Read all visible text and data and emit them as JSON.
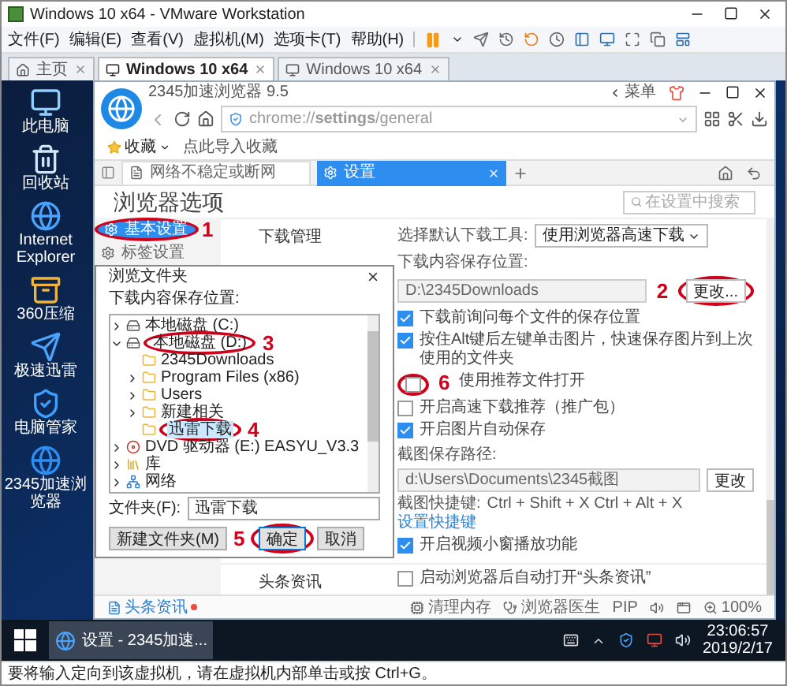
{
  "window": {
    "title": "Windows 10 x64 - VMware Workstation"
  },
  "menu": [
    "文件(F)",
    "编辑(E)",
    "查看(V)",
    "虚拟机(M)",
    "选项卡(T)",
    "帮助(H)"
  ],
  "vm_tabs": [
    {
      "label": "主页",
      "selected": false
    },
    {
      "label": "Windows 10 x64",
      "selected": true
    },
    {
      "label": "Windows 10 x64",
      "selected": false
    }
  ],
  "desktop_icons": [
    {
      "label": "此电脑",
      "kind": "computer"
    },
    {
      "label": "回收站",
      "kind": "bin"
    },
    {
      "label": "Internet Explorer",
      "kind": "ie"
    },
    {
      "label": "360压缩",
      "kind": "archive"
    },
    {
      "label": "极速迅雷",
      "kind": "bird"
    },
    {
      "label": "电脑管家",
      "kind": "shield"
    },
    {
      "label": "2345加速浏览器",
      "kind": "browser"
    }
  ],
  "browser": {
    "title": "2345加速浏览器 9.5",
    "menu": "菜单",
    "address": "chrome://**settings**/general",
    "favorites": [
      "收藏",
      "点此导入收藏"
    ],
    "tabs": [
      {
        "label": "网络不稳定或断网",
        "selected": false
      },
      {
        "label": "设置",
        "selected": true
      }
    ],
    "status": {
      "news": "头条资讯",
      "items": [
        {
          "kind": "memory",
          "label": "清理内存"
        },
        {
          "kind": "doctor",
          "label": "浏览器医生"
        },
        {
          "kind": "text",
          "label": "PIP"
        },
        {
          "kind": "sound"
        },
        {
          "kind": "window"
        },
        {
          "kind": "zoom",
          "label": "100%"
        }
      ]
    }
  },
  "settings": {
    "title": "浏览器选项",
    "search": {
      "placeholder": "在设置中搜索"
    },
    "sidebar": [
      {
        "label": "基本设置",
        "selected": true,
        "annotation": "1"
      },
      {
        "label": "标签设置",
        "selected": false
      }
    ],
    "sections": [
      {
        "label": "下载管理",
        "rows": [
          {
            "kind": "select",
            "label": "选择默认下载工具:",
            "value": "使用浏览器高速下载"
          },
          {
            "kind": "path",
            "label": "下载内容保存位置:",
            "value": "D:\\2345Downloads",
            "button": "更改...",
            "annotation": "2"
          },
          {
            "kind": "checkbox",
            "label": "下载前询问每个文件的保存位置",
            "checked": true
          },
          {
            "kind": "checkbox",
            "label": "按住Alt键后左键单击图片，快速保存图片到上次使用的文件夹",
            "checked": true
          },
          {
            "kind": "checkbox",
            "label": "使用推荐文件打开",
            "checked": false,
            "annotation": "6"
          },
          {
            "kind": "checkbox",
            "label": "开启高速下载推荐（推广包）",
            "checked": false
          },
          {
            "kind": "checkbox",
            "label": "开启图片自动保存",
            "checked": true
          },
          {
            "kind": "path",
            "label": "截图保存路径:",
            "value": "d:\\Users\\Documents\\2345截图",
            "button": "更改"
          },
          {
            "kind": "shortcut",
            "label": "截图快捷键:",
            "value": "Ctrl + Shift + X  Ctrl + Alt + X",
            "link": "设置快捷键"
          },
          {
            "kind": "checkbox",
            "label": "开启视频小窗播放功能",
            "checked": true
          }
        ]
      },
      {
        "label": "头条资讯",
        "rows": [
          {
            "kind": "checkbox",
            "label": "启动浏览器后自动打开“头条资讯”",
            "checked": false
          }
        ]
      }
    ]
  },
  "dialog": {
    "title": "浏览文件夹",
    "prompt": "下载内容保存位置:",
    "tree": [
      {
        "label": "本地磁盘 (C:)",
        "kind": "drive",
        "expanded": false,
        "selected": false
      },
      {
        "label": "本地磁盘 (D:)",
        "kind": "drive",
        "expanded": true,
        "selected": false,
        "annotation": "3",
        "children": [
          {
            "label": "2345Downloads",
            "kind": "folder",
            "selected": false
          },
          {
            "label": "Program Files (x86)",
            "kind": "folder",
            "expanded": false,
            "selected": false
          },
          {
            "label": "Users",
            "kind": "folder",
            "expanded": false,
            "selected": false
          },
          {
            "label": "新建相关",
            "kind": "folder",
            "expanded": false,
            "selected": false
          },
          {
            "label": "迅雷下载",
            "kind": "folder",
            "selected": true,
            "annotation": "4"
          }
        ]
      },
      {
        "label": "DVD 驱动器 (E:) EASYU_V3.3",
        "kind": "dvd",
        "expanded": false,
        "selected": false
      },
      {
        "label": "库",
        "kind": "library",
        "expanded": false,
        "selected": false
      },
      {
        "label": "网络",
        "kind": "network",
        "expanded": false,
        "selected": false
      }
    ],
    "folder_label": "文件夹(F):",
    "folder_value": "迅雷下载",
    "buttons": [
      {
        "label": "新建文件夹(M)",
        "kind": "secondary"
      },
      {
        "label": "确定",
        "kind": "primary",
        "annotation": "5"
      },
      {
        "label": "取消",
        "kind": "secondary"
      }
    ]
  },
  "taskbar": {
    "task": "设置 - 2345加速...",
    "time": "23:06:57",
    "date": "2019/2/17"
  },
  "status_bar": "要将输入定向到该虚拟机，请在虚拟机内部单击或按 Ctrl+G。"
}
